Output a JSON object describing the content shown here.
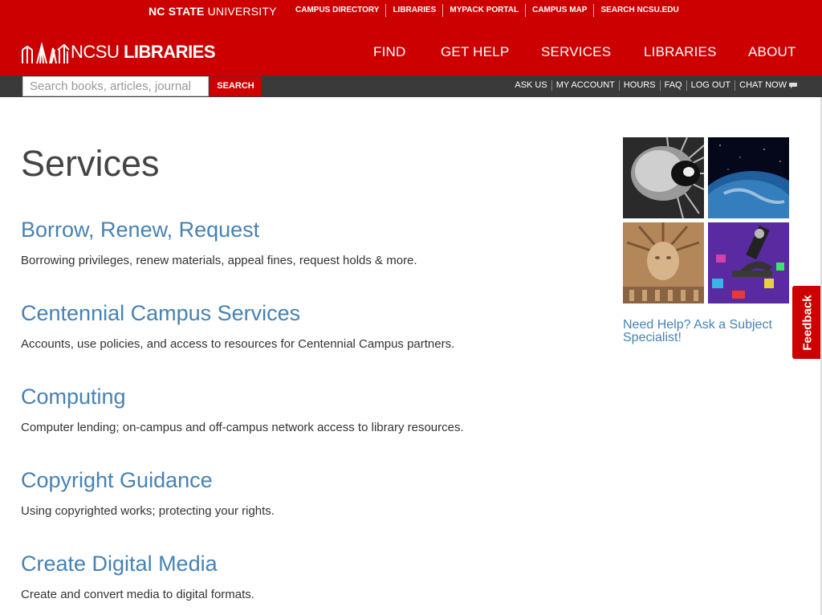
{
  "brand": {
    "university_bold": "NC STATE",
    "university_rest": "UNIVERSITY",
    "logo_light": "NCSU",
    "logo_bold": "LIBRARIES",
    "red": "#cc0000",
    "link_blue": "#4682b4"
  },
  "top_links": [
    "CAMPUS DIRECTORY",
    "LIBRARIES",
    "MYPACK PORTAL",
    "CAMPUS MAP",
    "SEARCH NCSU.EDU"
  ],
  "main_nav": {
    "find": "FIND",
    "get_help": "GET HELP",
    "services": "SERVICES",
    "libraries": "LIBRARIES",
    "about": "ABOUT"
  },
  "search": {
    "placeholder": "Search books, articles, journal",
    "button": "SEARCH"
  },
  "utility": {
    "ask_us": "ASK US",
    "my_account": "MY ACCOUNT",
    "hours": "HOURS",
    "faq": "FAQ",
    "log_out": "LOG OUT",
    "chat_now": "CHAT NOW",
    "chat_icon": "speech-bubble-icon"
  },
  "page": {
    "title": "Services"
  },
  "services": [
    {
      "title": "Borrow, Renew, Request",
      "desc": "Borrowing privileges, renew materials, appeal fines, request holds & more."
    },
    {
      "title": "Centennial Campus Services",
      "desc": "Accounts, use policies, and access to resources for Centennial Campus partners."
    },
    {
      "title": "Computing",
      "desc": "Computer lending; on-campus and off-campus network access to library resources."
    },
    {
      "title": "Copyright Guidance",
      "desc": "Using copyrighted works; protecting your rights."
    },
    {
      "title": "Create Digital Media",
      "desc": "Create and convert media to digital formats."
    }
  ],
  "sidebar": {
    "help_link": "Need Help? Ask a Subject Specialist!"
  },
  "feedback": {
    "label": "Feedback"
  }
}
